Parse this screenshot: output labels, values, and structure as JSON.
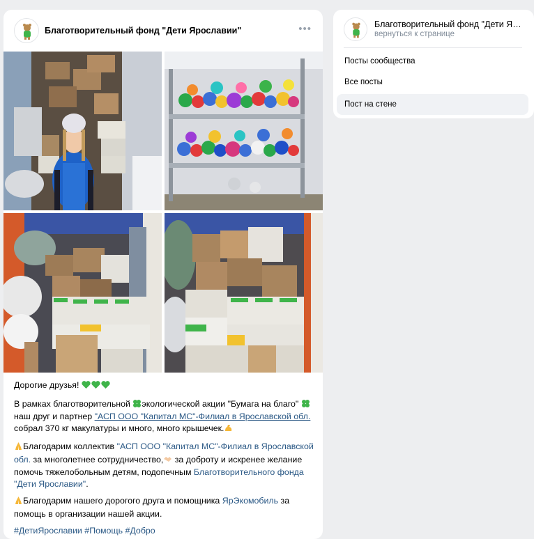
{
  "post": {
    "author": "Благотворительный фонд  \"Дети Ярославии\"",
    "more_label": "•••",
    "photos": [
      {
        "subject": "volunteer in blue vest in truck with boxes"
      },
      {
        "subject": "shelves with plastic bottle caps"
      },
      {
        "subject": "truck full of boxes"
      },
      {
        "subject": "boxes loaded in truck"
      }
    ],
    "text": {
      "greeting": "Дорогие друзья!",
      "p2_a": "В рамках благотворительной ",
      "p2_b": "экологической акции \"Бумага на благо\" ",
      "p2_c": " наш друг и партнер ",
      "p2_link": "\"АСП ООО \"Капитал МС\"-Филиал в Ярославской обл.",
      "p2_d": " собрал 370 кг макулатуры и много, много крышечек.",
      "p3_a": "Благодарим коллектив ",
      "p3_link1": "\"АСП ООО \"Капитал МС\"-Филиал в Ярославской обл.",
      "p3_b": " за многолетнее сотрудничество,",
      "p3_c": " за доброту и искренее желание помочь тяжелобольным детям, подопечным ",
      "p3_link2": "Благотворительного фонда \"Дети Ярославии\"",
      "p3_d": ".",
      "p4_a": "Благодарим нашего дорогого друга и помощника ",
      "p4_link": "ЯрЭкомобиль",
      "p4_b": " за помощь в организации нашей акции.",
      "tags": [
        "#ДетиЯрославии",
        "#Помощь",
        "#Добро"
      ]
    }
  },
  "sidebar": {
    "community_name": "Благотворительный фонд \"Дети Ярославии\"",
    "back_label": "вернуться к странице",
    "menu": [
      {
        "label": "Посты сообщества",
        "active": false
      },
      {
        "label": "Все посты",
        "active": false
      },
      {
        "label": "Пост на стене",
        "active": true
      }
    ]
  },
  "colors": {
    "link": "#2a5885",
    "page_bg": "#edeef0",
    "accent_green": "#3fb44a"
  }
}
